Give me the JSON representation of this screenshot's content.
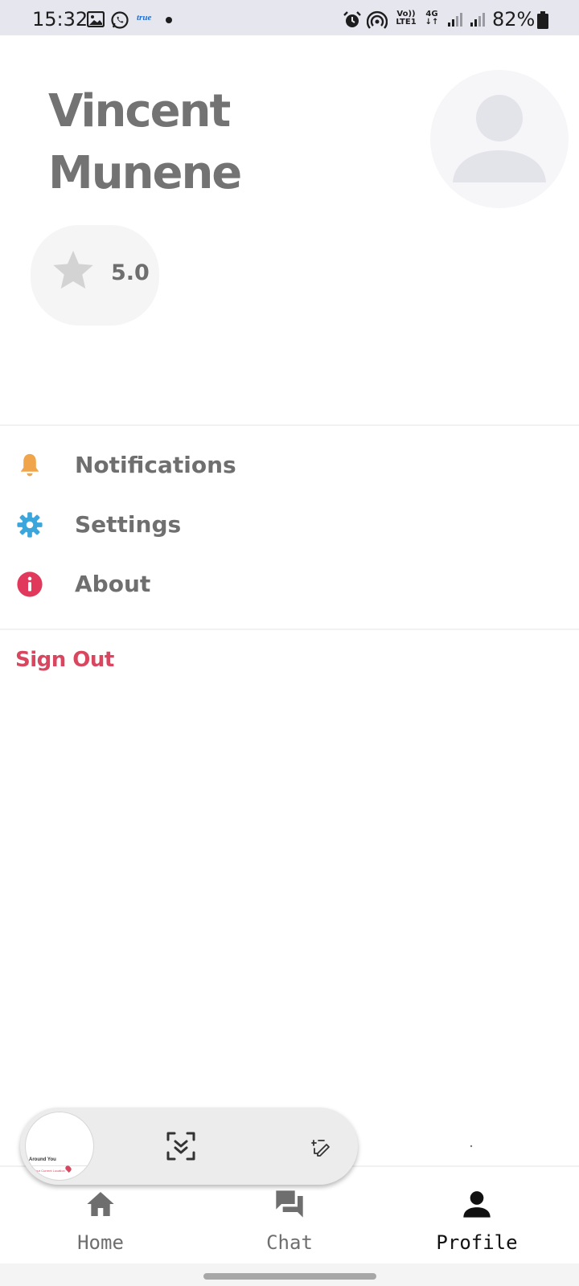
{
  "status_bar": {
    "time": "15:32",
    "carrier_badge": "true",
    "volte_top": "Vo))",
    "volte_bottom": "LTE1",
    "network": "4G",
    "battery": "82%"
  },
  "profile": {
    "first_name": "Vincent",
    "last_name": "Munene",
    "rating": "5.0",
    "avatar_icon": "person-icon",
    "rating_icon": "star-icon"
  },
  "menu": {
    "items": [
      {
        "label": "Notifications",
        "icon": "bell-icon",
        "color": "#f0a54a"
      },
      {
        "label": "Settings",
        "icon": "gear-icon",
        "color": "#3aa6dc"
      },
      {
        "label": "About",
        "icon": "info-icon",
        "color": "#e0395c"
      }
    ],
    "sign_out": "Sign Out",
    "sign_out_color": "#d8465f"
  },
  "screenshot_toolbar": {
    "thumbnail_text": "Around You",
    "thumbnail_subtext": "Your Current Location"
  },
  "bottom_nav": {
    "items": [
      {
        "label": "Home",
        "icon": "home-icon",
        "active": false
      },
      {
        "label": "Chat",
        "icon": "chat-icon",
        "active": false
      },
      {
        "label": "Profile",
        "icon": "person-icon",
        "active": true
      }
    ]
  }
}
